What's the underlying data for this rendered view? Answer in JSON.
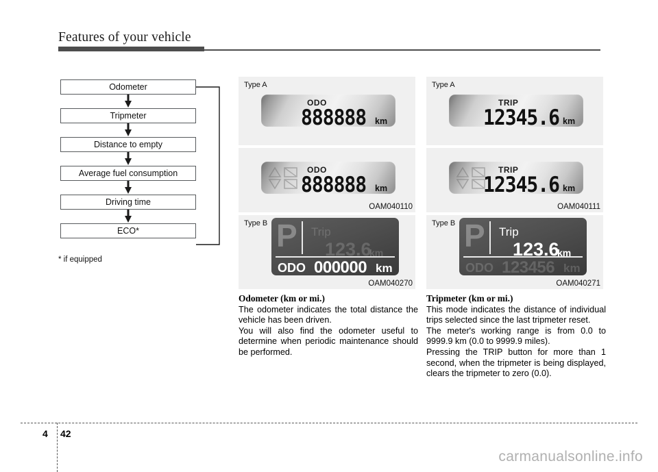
{
  "header": {
    "chapter_title": "Features of your vehicle"
  },
  "flowchart": {
    "steps": [
      {
        "label": "Odometer"
      },
      {
        "label": "Tripmeter"
      },
      {
        "label": "Distance to empty"
      },
      {
        "label": "Average fuel consumption"
      },
      {
        "label": "Driving time"
      },
      {
        "label": "ECO*"
      }
    ],
    "footnote": "* if equipped"
  },
  "figures": {
    "odometer": {
      "type_a_1": {
        "type_label": "Type A",
        "mode": "ODO",
        "digits": "888888",
        "unit": "km"
      },
      "type_a_2": {
        "type_label": "",
        "mode": "ODO",
        "digits": "888888",
        "unit": "km",
        "code": "OAM040110"
      },
      "type_b": {
        "type_label": "Type B",
        "gear": "P",
        "top_label": "Trip",
        "top_value": "123.6",
        "top_unit": "km",
        "bottom_label": "ODO",
        "bottom_value": "000000",
        "bottom_unit": "km",
        "code": "OAM040270"
      }
    },
    "tripmeter": {
      "type_a_1": {
        "type_label": "Type A",
        "mode": "TRIP",
        "digits": "12345.6",
        "unit": "km"
      },
      "type_a_2": {
        "type_label": "",
        "mode": "TRIP",
        "digits": "12345.6",
        "unit": "km",
        "code": "OAM040111"
      },
      "type_b": {
        "type_label": "Type B",
        "gear": "P",
        "top_label": "Trip",
        "top_value": "123.6",
        "top_unit": "km",
        "bottom_label": "ODO",
        "bottom_value": "123456",
        "bottom_unit": "km",
        "code": "OAM040271"
      }
    }
  },
  "content": {
    "left": {
      "heading": "Odometer (km or mi.)",
      "para1": "The odometer indicates the total distance the vehicle has been driven.",
      "para2": "You will also find the odometer useful to determine when periodic maintenance should be performed."
    },
    "right": {
      "heading": "Tripmeter (km or mi.)",
      "para1": "This mode indicates the distance of individual trips selected since the last tripmeter reset.",
      "para2": "The meter's working range is from 0.0 to 9999.9 km (0.0 to 9999.9 miles).",
      "para3": "Pressing the TRIP button for more than 1 second, when the tripmeter is being displayed, clears the tripmeter to zero (0.0)."
    }
  },
  "footer": {
    "chapter_number": "4",
    "page_number": "42",
    "watermark": "carmanualsonline.info"
  }
}
